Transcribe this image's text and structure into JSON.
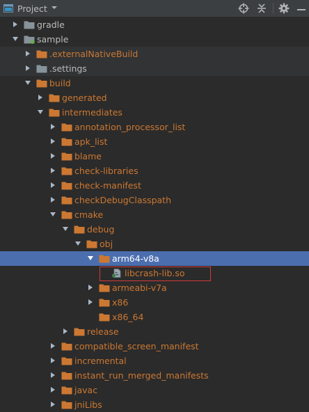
{
  "header": {
    "title": "Project"
  },
  "tree": [
    {
      "label": "gradle",
      "depth": 0,
      "arrow": "right",
      "icon": "folder",
      "tone": "grey",
      "state": ""
    },
    {
      "label": "sample",
      "depth": 0,
      "arrow": "down",
      "icon": "module",
      "tone": "grey",
      "state": ""
    },
    {
      "label": ".externalNativeBuild",
      "depth": 1,
      "arrow": "right",
      "icon": "folder",
      "tone": "orange",
      "state": "band"
    },
    {
      "label": ".settings",
      "depth": 1,
      "arrow": "right",
      "icon": "folder",
      "tone": "grey",
      "state": "band"
    },
    {
      "label": "build",
      "depth": 1,
      "arrow": "down",
      "icon": "folder",
      "tone": "orange",
      "state": ""
    },
    {
      "label": "generated",
      "depth": 2,
      "arrow": "right",
      "icon": "folder",
      "tone": "orange",
      "state": ""
    },
    {
      "label": "intermediates",
      "depth": 2,
      "arrow": "down",
      "icon": "folder",
      "tone": "orange",
      "state": ""
    },
    {
      "label": "annotation_processor_list",
      "depth": 3,
      "arrow": "right",
      "icon": "folder",
      "tone": "orange",
      "state": ""
    },
    {
      "label": "apk_list",
      "depth": 3,
      "arrow": "right",
      "icon": "folder",
      "tone": "orange",
      "state": ""
    },
    {
      "label": "blame",
      "depth": 3,
      "arrow": "right",
      "icon": "folder",
      "tone": "orange",
      "state": ""
    },
    {
      "label": "check-libraries",
      "depth": 3,
      "arrow": "right",
      "icon": "folder",
      "tone": "orange",
      "state": ""
    },
    {
      "label": "check-manifest",
      "depth": 3,
      "arrow": "right",
      "icon": "folder",
      "tone": "orange",
      "state": ""
    },
    {
      "label": "checkDebugClasspath",
      "depth": 3,
      "arrow": "right",
      "icon": "folder",
      "tone": "orange",
      "state": ""
    },
    {
      "label": "cmake",
      "depth": 3,
      "arrow": "down",
      "icon": "folder",
      "tone": "orange",
      "state": ""
    },
    {
      "label": "debug",
      "depth": 4,
      "arrow": "down",
      "icon": "folder",
      "tone": "orange",
      "state": ""
    },
    {
      "label": "obj",
      "depth": 5,
      "arrow": "down",
      "icon": "folder",
      "tone": "orange",
      "state": ""
    },
    {
      "label": "arm64-v8a",
      "depth": 6,
      "arrow": "down",
      "icon": "folder",
      "tone": "orange",
      "state": "sel"
    },
    {
      "label": "libcrash-lib.so",
      "depth": 7,
      "arrow": "",
      "icon": "file",
      "tone": "orange",
      "state": ""
    },
    {
      "label": "armeabi-v7a",
      "depth": 6,
      "arrow": "right",
      "icon": "folder",
      "tone": "orange",
      "state": ""
    },
    {
      "label": "x86",
      "depth": 6,
      "arrow": "right",
      "icon": "folder",
      "tone": "orange",
      "state": ""
    },
    {
      "label": "x86_64",
      "depth": 6,
      "arrow": "",
      "icon": "folder",
      "tone": "orange",
      "state": ""
    },
    {
      "label": "release",
      "depth": 4,
      "arrow": "right",
      "icon": "folder",
      "tone": "orange",
      "state": ""
    },
    {
      "label": "compatible_screen_manifest",
      "depth": 3,
      "arrow": "right",
      "icon": "folder",
      "tone": "orange",
      "state": ""
    },
    {
      "label": "incremental",
      "depth": 3,
      "arrow": "right",
      "icon": "folder",
      "tone": "orange",
      "state": ""
    },
    {
      "label": "instant_run_merged_manifests",
      "depth": 3,
      "arrow": "right",
      "icon": "folder",
      "tone": "orange",
      "state": ""
    },
    {
      "label": "javac",
      "depth": 3,
      "arrow": "right",
      "icon": "folder",
      "tone": "orange",
      "state": ""
    },
    {
      "label": "jniLibs",
      "depth": 3,
      "arrow": "right",
      "icon": "folder",
      "tone": "orange",
      "state": ""
    }
  ],
  "colors": {
    "background": "#2b2b2b",
    "header": "#3c3f41",
    "selection": "#4b6eaf",
    "folder_excluded": "#cc7832",
    "folder_normal": "#87939a",
    "highlight_box": "#d23b3b"
  }
}
